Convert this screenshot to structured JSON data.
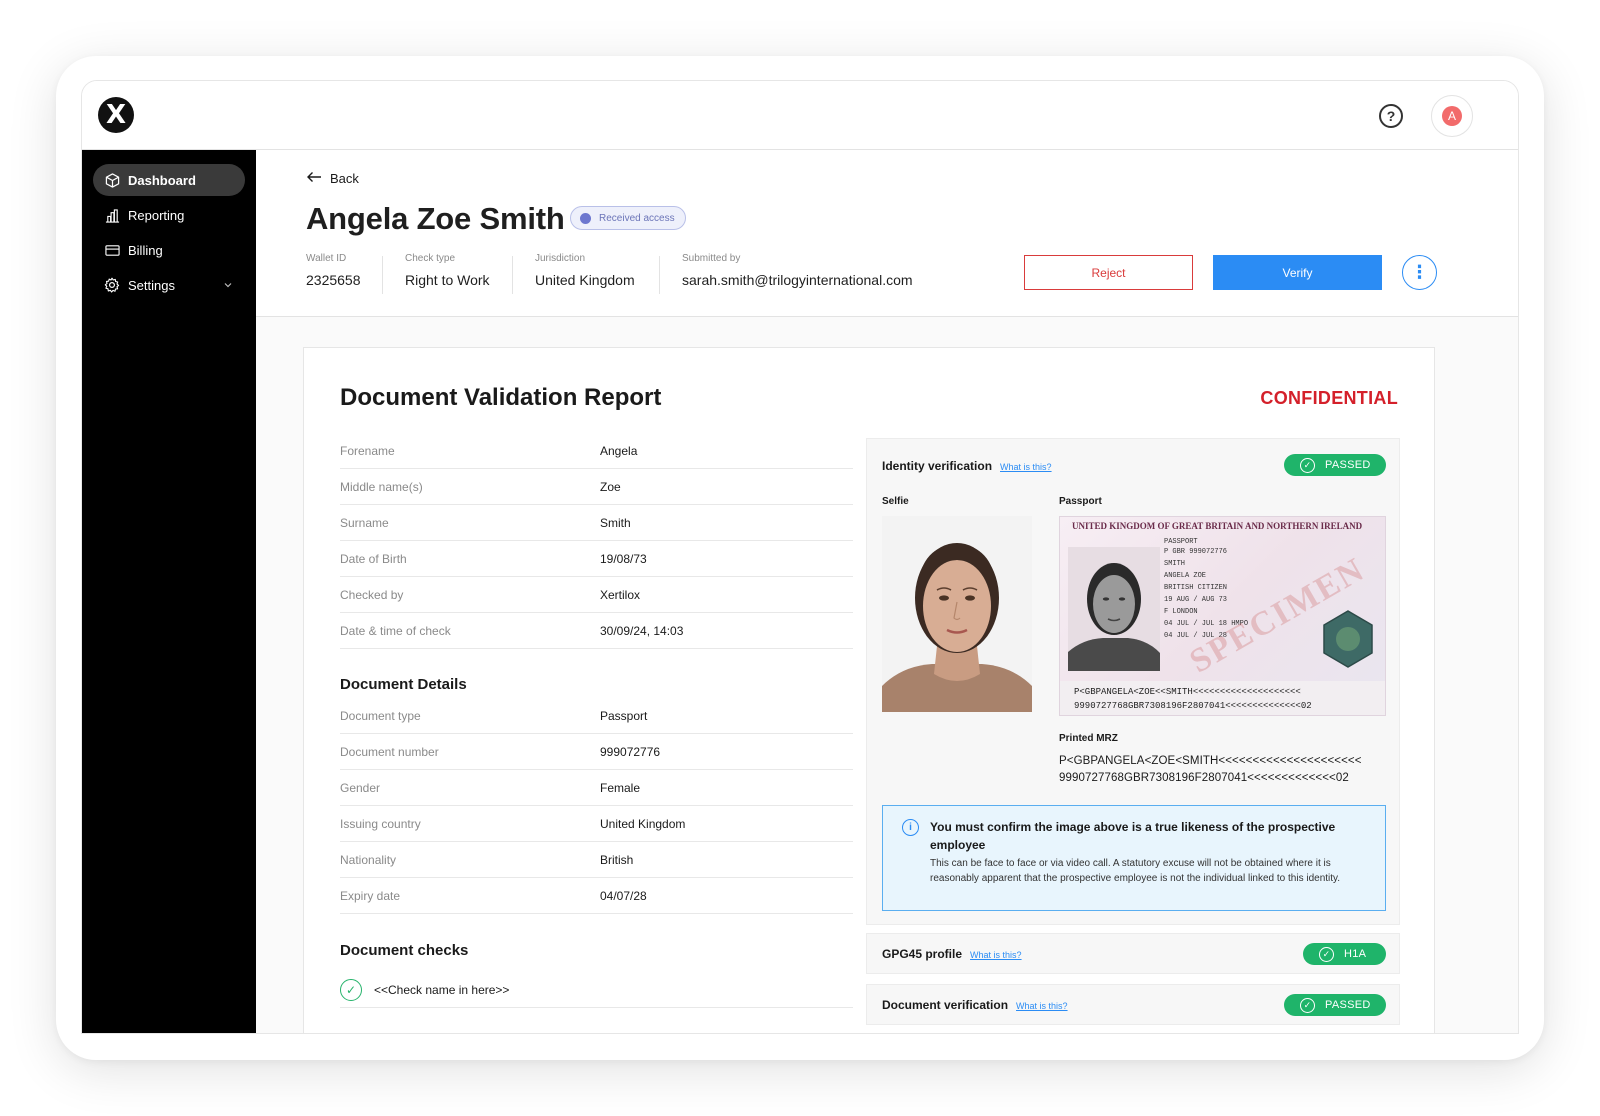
{
  "app": {
    "logo_glyph": "X"
  },
  "topbar": {
    "help_glyph": "?",
    "avatar_initial": "A"
  },
  "sidebar": {
    "items": [
      {
        "label": "Dashboard",
        "icon": "cube-icon",
        "active": true
      },
      {
        "label": "Reporting",
        "icon": "bar-chart-icon",
        "active": false
      },
      {
        "label": "Billing",
        "icon": "card-icon",
        "active": false
      },
      {
        "label": "Settings",
        "icon": "gear-icon",
        "active": false
      }
    ]
  },
  "header": {
    "back_label": "Back",
    "name": "Angela Zoe Smith",
    "status_badge": "Received access",
    "meta": [
      {
        "label": "Wallet ID",
        "value": "2325658"
      },
      {
        "label": "Check type",
        "value": "Right to Work"
      },
      {
        "label": "Jurisdiction",
        "value": "United Kingdom"
      },
      {
        "label": "Submitted by",
        "value": "sarah.smith@trilogyinternational.com"
      }
    ],
    "reject_label": "Reject",
    "verify_label": "Verify",
    "more_glyph": "⋮"
  },
  "report": {
    "title": "Document Validation Report",
    "confidential": "CONFIDENTIAL",
    "person_rows": [
      {
        "k": "Forename",
        "v": "Angela"
      },
      {
        "k": "Middle name(s)",
        "v": "Zoe"
      },
      {
        "k": "Surname",
        "v": "Smith"
      },
      {
        "k": "Date of Birth",
        "v": "19/08/73"
      },
      {
        "k": "Checked by",
        "v": "Xertilox"
      },
      {
        "k": "Date & time of check",
        "v": "30/09/24, 14:03"
      }
    ],
    "details_title": "Document Details",
    "detail_rows": [
      {
        "k": "Document type",
        "v": "Passport"
      },
      {
        "k": "Document number",
        "v": "999072776"
      },
      {
        "k": "Gender",
        "v": "Female"
      },
      {
        "k": "Issuing country",
        "v": "United Kingdom"
      },
      {
        "k": "Nationality",
        "v": "British"
      },
      {
        "k": "Expiry date",
        "v": "04/07/28"
      }
    ],
    "checks_title": "Document checks",
    "check_item": "<<Check name in here>>"
  },
  "identity": {
    "title": "Identity verification",
    "what_is_this": "What is this?",
    "status": "PASSED",
    "selfie_label": "Selfie",
    "passport_label": "Passport",
    "passport_header": "UNITED KINGDOM OF GREAT BRITAIN AND NORTHERN IRELAND",
    "passport_fields": [
      "PASSPORT",
      "P    GBR    999072776",
      "SMITH",
      "ANGELA ZOE",
      "BRITISH CITIZEN",
      "19 AUG / AUG 73",
      "F    LONDON",
      "04 JUL / JUL 18   HMPO",
      "04 JUL / JUL 28"
    ],
    "specimen": "SPECIMEN",
    "mrz_image_line1": "P<GBPANGELA<ZOE<<SMITH<<<<<<<<<<<<<<<<<<<<",
    "mrz_image_line2": "9990727768GBR7308196F2807041<<<<<<<<<<<<<<02",
    "printed_mrz_label": "Printed MRZ",
    "printed_mrz_line1": "P<GBPANGELA<ZOE<SMITH<<<<<<<<<<<<<<<<<<<<<",
    "printed_mrz_line2": "9990727768GBR7308196F2807041<<<<<<<<<<<<<02",
    "notice_title": "You must confirm the image above is a true likeness of the prospective employee",
    "notice_body": "This can be face to face or via video call. A statutory excuse will not be obtained where it is reasonably apparent that the prospective employee is not the individual linked to this identity."
  },
  "gpg45": {
    "title": "GPG45 profile",
    "what_is_this": "What is this?",
    "status": "H1A"
  },
  "docverif": {
    "title": "Document verification",
    "what_is_this": "What is this?",
    "status": "PASSED"
  },
  "colors": {
    "accent": "#2b8cf4",
    "reject": "#d93b3b",
    "passed": "#1fb46a",
    "confidential": "#d4202a"
  }
}
